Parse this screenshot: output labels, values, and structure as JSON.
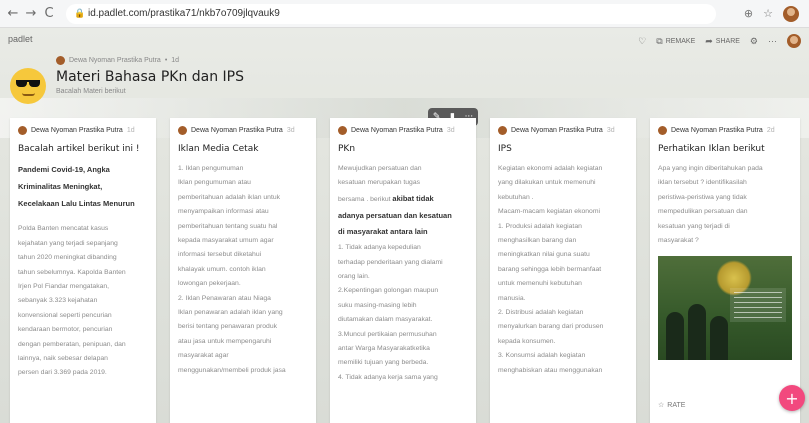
{
  "browser": {
    "url": "id.padlet.com/prastika71/nkb7o709jlqvauk9",
    "back_icon": "←",
    "forward_icon": "→",
    "reload_icon": "C",
    "lock_icon": "🔒",
    "translate_icon": "⊕",
    "star_icon": "☆"
  },
  "padlet": {
    "brand": "padlet",
    "toolbar": {
      "heart_icon": "♡",
      "remake_label": "REMAKE",
      "remake_icon": "⧉",
      "share_label": "SHARE",
      "share_icon": "➦",
      "settings_icon": "⚙",
      "more_icon": "···"
    },
    "header": {
      "author": "Dewa Nyoman Prastika Putra",
      "separator": "•",
      "ago": "1d",
      "title": "Materi Bahasa PKn dan IPS",
      "subtitle": "Bacalah Materi berikut"
    },
    "floating_tools": {
      "edit": "✎",
      "delete": "▮",
      "more": "···"
    },
    "columns": [
      {
        "author": "Dewa Nyoman Prastika Putra",
        "ago": "1d",
        "title": "Bacalah artikel berikut ini !",
        "bold_lines": [
          "Pandemi Covid-19, Angka",
          "Kriminalitas Meningkat,",
          "Kecelakaan Lalu Lintas Menurun"
        ],
        "lines": [
          "Polda Banten mencatat kasus",
          "kejahatan yang terjadi sepanjang",
          "tahun 2020 meningkat dibanding",
          "tahun sebelumnya. Kapolda Banten",
          "Irjen Pol Fiandar mengatakan,",
          "sebanyak 3.323 kejahatan",
          "konvensional seperti pencurian",
          "kendaraan bermotor, pencurian",
          "dengan pemberatan, penipuan, dan",
          "lainnya, naik sebesar delapan",
          "persen dari 3.369 pada 2019."
        ]
      },
      {
        "author": "Dewa Nyoman Prastika Putra",
        "ago": "3d",
        "title": "Iklan Media Cetak",
        "lines": [
          "1. Iklan pengumuman",
          "Iklan pengumuman atau",
          "pemberitahuan adalah iklan untuk",
          "menyampaikan informasi atau",
          "pemberitahuan tentang suatu hal",
          "kepada masyarakat umum agar",
          "informasi tersebut diketahui",
          "khalayak umum. contoh iklan",
          "lowongan pekerjaan.",
          "2. Iklan Penawaran atau Niaga",
          "Iklan penawaran adalah iklan yang",
          "berisi tentang penawaran produk",
          "atau jasa untuk mempengaruhi",
          "masyarakat agar",
          "menggunakan/membeli produk jasa"
        ]
      },
      {
        "author": "Dewa Nyoman Prastika Putra",
        "ago": "3d",
        "title": "PKn",
        "lines_a": [
          "Mewujudkan persatuan dan",
          "kesatuan merupakan tugas"
        ],
        "mixed_line_prefix": "bersama . berikut",
        "mixed_line_bold": "akibat tidak",
        "bold_lines": [
          "adanya persatuan dan kesatuan",
          "di masyarakat antara lain"
        ],
        "lines_b": [
          "1. Tidak adanya kepedulian",
          "terhadap penderitaan yang dialami",
          "orang lain.",
          "2.Kepentingan golongan maupun",
          "suku masing-masing lebih",
          "diutamakan dalam masyarakat.",
          "3.Muncul pertikaian permusuhan",
          "antar Warga Masyarakatketika",
          "memiliki tujuan yang berbeda.",
          "4. Tidak adanya kerja sama yang"
        ]
      },
      {
        "author": "Dewa Nyoman Prastika Putra",
        "ago": "3d",
        "title": "IPS",
        "lines": [
          "Kegiatan ekonomi adalah kegiatan",
          "yang dilakukan untuk memenuhi",
          "kebutuhan .",
          "Macam-macam kegiatan ekonomi",
          "1. Produksi adalah kegiatan",
          "menghasilkan barang dan",
          "meningkatkan nilai guna suatu",
          "barang sehingga lebih bermanfaat",
          "untuk memenuhi kebutuhan",
          "manusia.",
          "2. Distribusi adalah kegiatan",
          "menyalurkan barang dari produsen",
          "kepada konsumen.",
          "3. Konsumsi adalah kegiatan",
          "menghabiskan atau menggunakan"
        ]
      },
      {
        "author": "Dewa Nyoman Prastika Putra",
        "ago": "2d",
        "title": "Perhatikan Iklan berikut",
        "lines": [
          "Apa yang ingin diberitahukan pada",
          "iklan tersebut ? identifikasilah",
          "peristiwa-peristiwa yang tidak",
          "mempedulikan persatuan dan",
          "kesatuan yang terjadi di",
          "masyarakat ?"
        ],
        "rate_icon": "☆",
        "rate_label": "RATE"
      }
    ],
    "fab_icon": "+"
  }
}
